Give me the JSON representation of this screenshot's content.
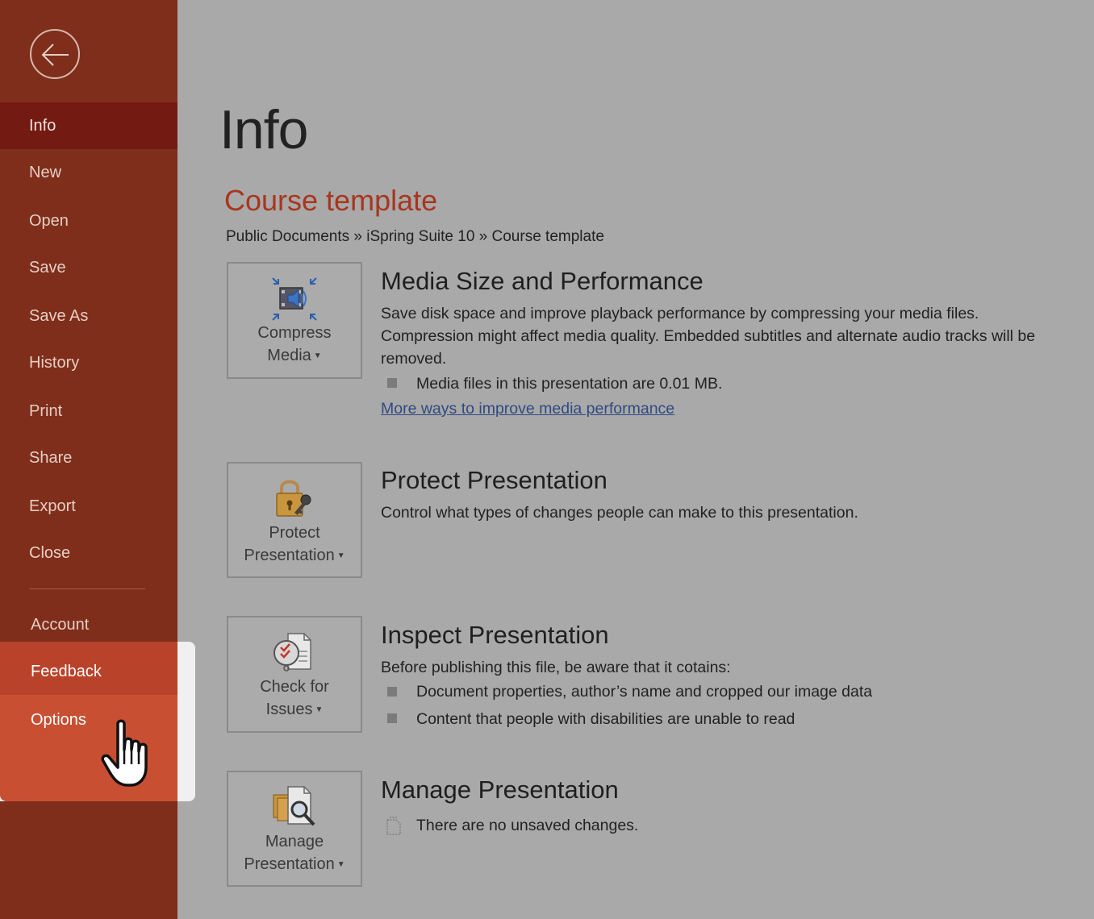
{
  "sidebar": {
    "items": [
      {
        "label": "Info"
      },
      {
        "label": "New"
      },
      {
        "label": "Open"
      },
      {
        "label": "Save"
      },
      {
        "label": "Save As"
      },
      {
        "label": "History"
      },
      {
        "label": "Print"
      },
      {
        "label": "Share"
      },
      {
        "label": "Export"
      },
      {
        "label": "Close"
      }
    ],
    "account": "Account",
    "feedback": "Feedback",
    "options": "Options"
  },
  "main": {
    "title": "Info",
    "document_title": "Course template",
    "breadcrumb": "Public Documents » iSpring Suite 10 » Course template",
    "media": {
      "tile_line1": "Compress",
      "tile_line2": "Media",
      "title": "Media Size and Performance",
      "desc": "Save disk space and improve playback performance by compressing your media files. Compression might affect media quality. Embedded subtitles and alternate audio tracks will be removed.",
      "bullet": "Media files in this presentation are 0.01 MB.",
      "link": "More ways to improve media performance"
    },
    "protect": {
      "tile_line1": "Protect",
      "tile_line2": "Presentation",
      "title": "Protect Presentation",
      "desc": "Control what types of changes people can make to this presentation."
    },
    "inspect": {
      "tile_line1": "Check for",
      "tile_line2": "Issues",
      "title": "Inspect Presentation",
      "desc": "Before publishing this file, be aware that it cotains:",
      "bullets": [
        "Document properties, author’s name and cropped our image data",
        "Content that people with disabilities are unable to read"
      ]
    },
    "manage": {
      "tile_line1": "Manage",
      "tile_line2": "Presentation",
      "title": "Manage Presentation",
      "status": "There are no unsaved changes."
    }
  },
  "icons": {
    "back": "back-arrow-icon",
    "compress": "compress-media-icon",
    "protect": "lock-key-icon",
    "inspect": "check-issues-icon",
    "manage": "manage-presentation-icon",
    "cursor": "hand-pointer-icon"
  },
  "colors": {
    "sidebar": "#7e2e1a",
    "sidebar_active": "#731a12",
    "accent": "#a9351d",
    "feedback_hover": "#b9432a",
    "options_hover": "#c94f33",
    "link": "#2f4a82"
  }
}
